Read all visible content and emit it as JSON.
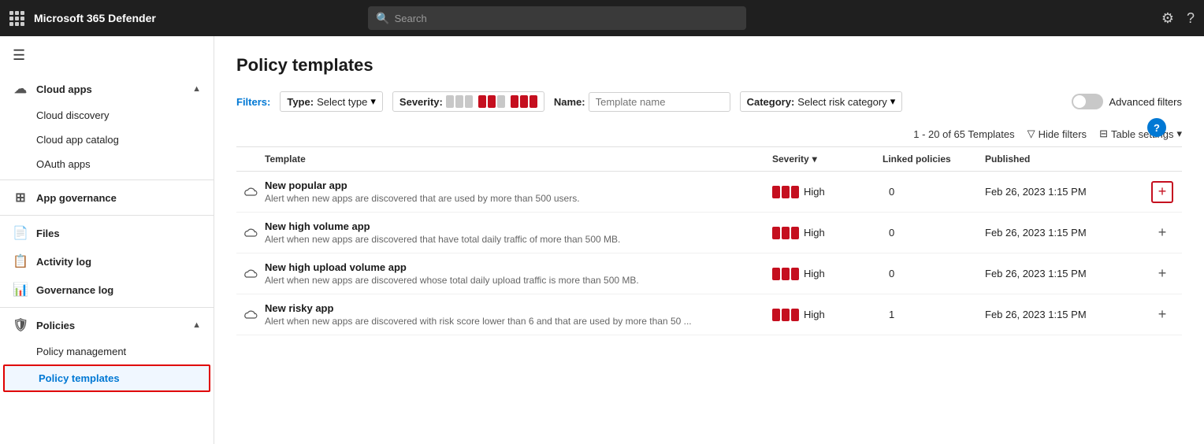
{
  "topbar": {
    "app_name": "Microsoft 365 Defender",
    "search_placeholder": "Search"
  },
  "sidebar": {
    "hamburger_label": "☰",
    "sections": [
      {
        "id": "cloud-apps",
        "label": "Cloud apps",
        "icon": "☁",
        "expanded": true,
        "items": [
          {
            "id": "cloud-discovery",
            "label": "Cloud discovery"
          },
          {
            "id": "cloud-app-catalog",
            "label": "Cloud app catalog"
          },
          {
            "id": "oauth-apps",
            "label": "OAuth apps"
          }
        ]
      },
      {
        "id": "app-governance",
        "label": "App governance",
        "icon": "⊞",
        "expanded": false,
        "items": []
      },
      {
        "id": "files",
        "label": "Files",
        "icon": "📄",
        "expanded": false,
        "items": []
      },
      {
        "id": "activity-log",
        "label": "Activity log",
        "icon": "📋",
        "expanded": false,
        "items": []
      },
      {
        "id": "governance-log",
        "label": "Governance log",
        "icon": "📊",
        "expanded": false,
        "items": []
      },
      {
        "id": "policies",
        "label": "Policies",
        "icon": "🛡",
        "expanded": true,
        "items": [
          {
            "id": "policy-management",
            "label": "Policy management"
          },
          {
            "id": "policy-templates",
            "label": "Policy templates",
            "active": true
          }
        ]
      }
    ]
  },
  "main": {
    "page_title": "Policy templates",
    "help_label": "?",
    "filters": {
      "label": "Filters:",
      "type_label": "Type:",
      "type_value": "Select type",
      "severity_label": "Severity:",
      "name_label": "Name:",
      "name_placeholder": "Template name",
      "category_label": "Category:",
      "category_value": "Select risk category",
      "advanced_label": "Advanced filters"
    },
    "table_meta": {
      "count": "1 - 20 of 65 Templates",
      "hide_filters": "Hide filters",
      "table_settings": "Table settings"
    },
    "columns": [
      {
        "id": "icon-col",
        "label": ""
      },
      {
        "id": "template",
        "label": "Template"
      },
      {
        "id": "severity",
        "label": "Severity"
      },
      {
        "id": "linked-policies",
        "label": "Linked policies"
      },
      {
        "id": "published",
        "label": "Published"
      },
      {
        "id": "action",
        "label": ""
      }
    ],
    "rows": [
      {
        "id": "row-1",
        "name": "New popular app",
        "desc": "Alert when new apps are discovered that are used by more than 500 users.",
        "desc_link": "500 users.",
        "severity": "High",
        "linked": "0",
        "published": "Feb 26, 2023 1:15 PM",
        "action_highlight": true
      },
      {
        "id": "row-2",
        "name": "New high volume app",
        "desc": "Alert when new apps are discovered that have total daily traffic of more than 500 MB.",
        "desc_link": "500 MB.",
        "severity": "High",
        "linked": "0",
        "published": "Feb 26, 2023 1:15 PM",
        "action_highlight": false
      },
      {
        "id": "row-3",
        "name": "New high upload volume app",
        "desc": "Alert when new apps are discovered whose total daily upload traffic is more than 500 MB.",
        "desc_link": "500 MB.",
        "severity": "High",
        "linked": "0",
        "published": "Feb 26, 2023 1:15 PM",
        "action_highlight": false
      },
      {
        "id": "row-4",
        "name": "New risky app",
        "desc": "Alert when new apps are discovered with risk score lower than 6 and that are used by more than 50 ...",
        "desc_link": "more than 50 ...",
        "severity": "High",
        "linked": "1",
        "published": "Feb 26, 2023 1:15 PM",
        "action_highlight": false
      }
    ]
  }
}
